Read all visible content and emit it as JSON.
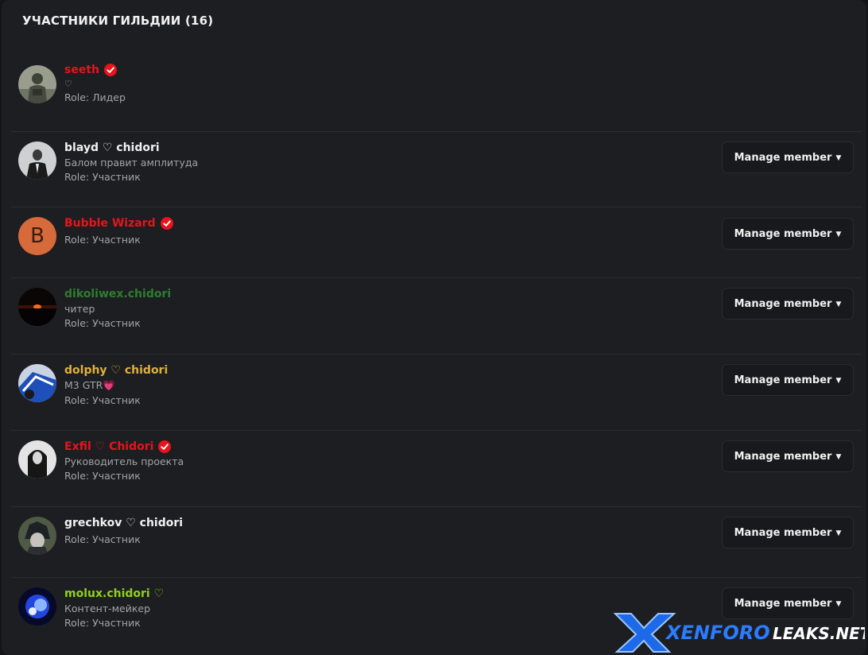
{
  "panel": {
    "title": "УЧАСТНИКИ ГИЛЬДИИ (16)"
  },
  "manage_label": "Manage member",
  "members": [
    {
      "name": "seeth",
      "name_color": "#e8131b",
      "verified": true,
      "subtitle": "♡",
      "role": "Role: Лидер",
      "avatar": "photo-soldier"
    },
    {
      "name": "blayd ♡ chidori",
      "name_color": "#f1f1f1",
      "verified": false,
      "subtitle": "Балом правит амплитуда",
      "role": "Role: Участник",
      "avatar": "photo-suit"
    },
    {
      "name": "Bubble Wizard",
      "name_color": "#e8131b",
      "verified": true,
      "subtitle": "",
      "role": "Role: Участник",
      "avatar": "letter-B",
      "avatar_letter": "B"
    },
    {
      "name": "dikoliwex.chidori",
      "name_color": "#2e7d2e",
      "verified": false,
      "subtitle": "читер",
      "role": "Role: Участник",
      "avatar": "photo-sunset"
    },
    {
      "name": "dolphy ♡ chidori",
      "name_color": "#e0b13a",
      "verified": false,
      "subtitle": "M3 GTR💗",
      "role": "Role: Участник",
      "avatar": "photo-car"
    },
    {
      "name": "Exfil ♡ Chidori",
      "name_color": "#e8131b",
      "verified": true,
      "subtitle": "Руководитель проекта",
      "role": "Role: Участник",
      "avatar": "photo-woman"
    },
    {
      "name": "grechkov ♡ chidori",
      "name_color": "#f1f1f1",
      "verified": false,
      "subtitle": "",
      "role": "Role: Участник",
      "avatar": "photo-anime"
    },
    {
      "name": "molux.chidori ♡",
      "name_color": "#8fd11a",
      "verified": false,
      "subtitle": "Контент-мейкер",
      "role": "Role: Участник",
      "avatar": "photo-blue"
    }
  ],
  "watermark": {
    "brand_left": "XENFORO",
    "brand_right": "LEAKS.NET"
  },
  "colors": {
    "panel_bg": "#1d1e22",
    "page_bg": "#141518",
    "verified_red": "#e8131b",
    "button_bg": "#18191c"
  }
}
